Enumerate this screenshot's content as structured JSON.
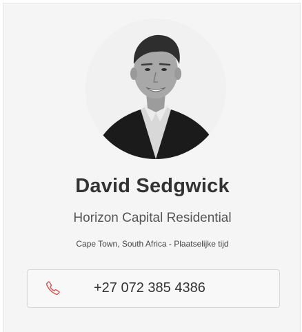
{
  "agent": {
    "name": "David Sedgwick",
    "company": "Horizon Capital Residential",
    "location": "Cape Town, South Africa - Plaatselijke tijd"
  },
  "contact": {
    "phone": "+27 072 385 4386",
    "phone_icon": "phone-icon"
  },
  "colors": {
    "phone_icon": "#d9534f",
    "card_background": "#f5f5f5"
  }
}
